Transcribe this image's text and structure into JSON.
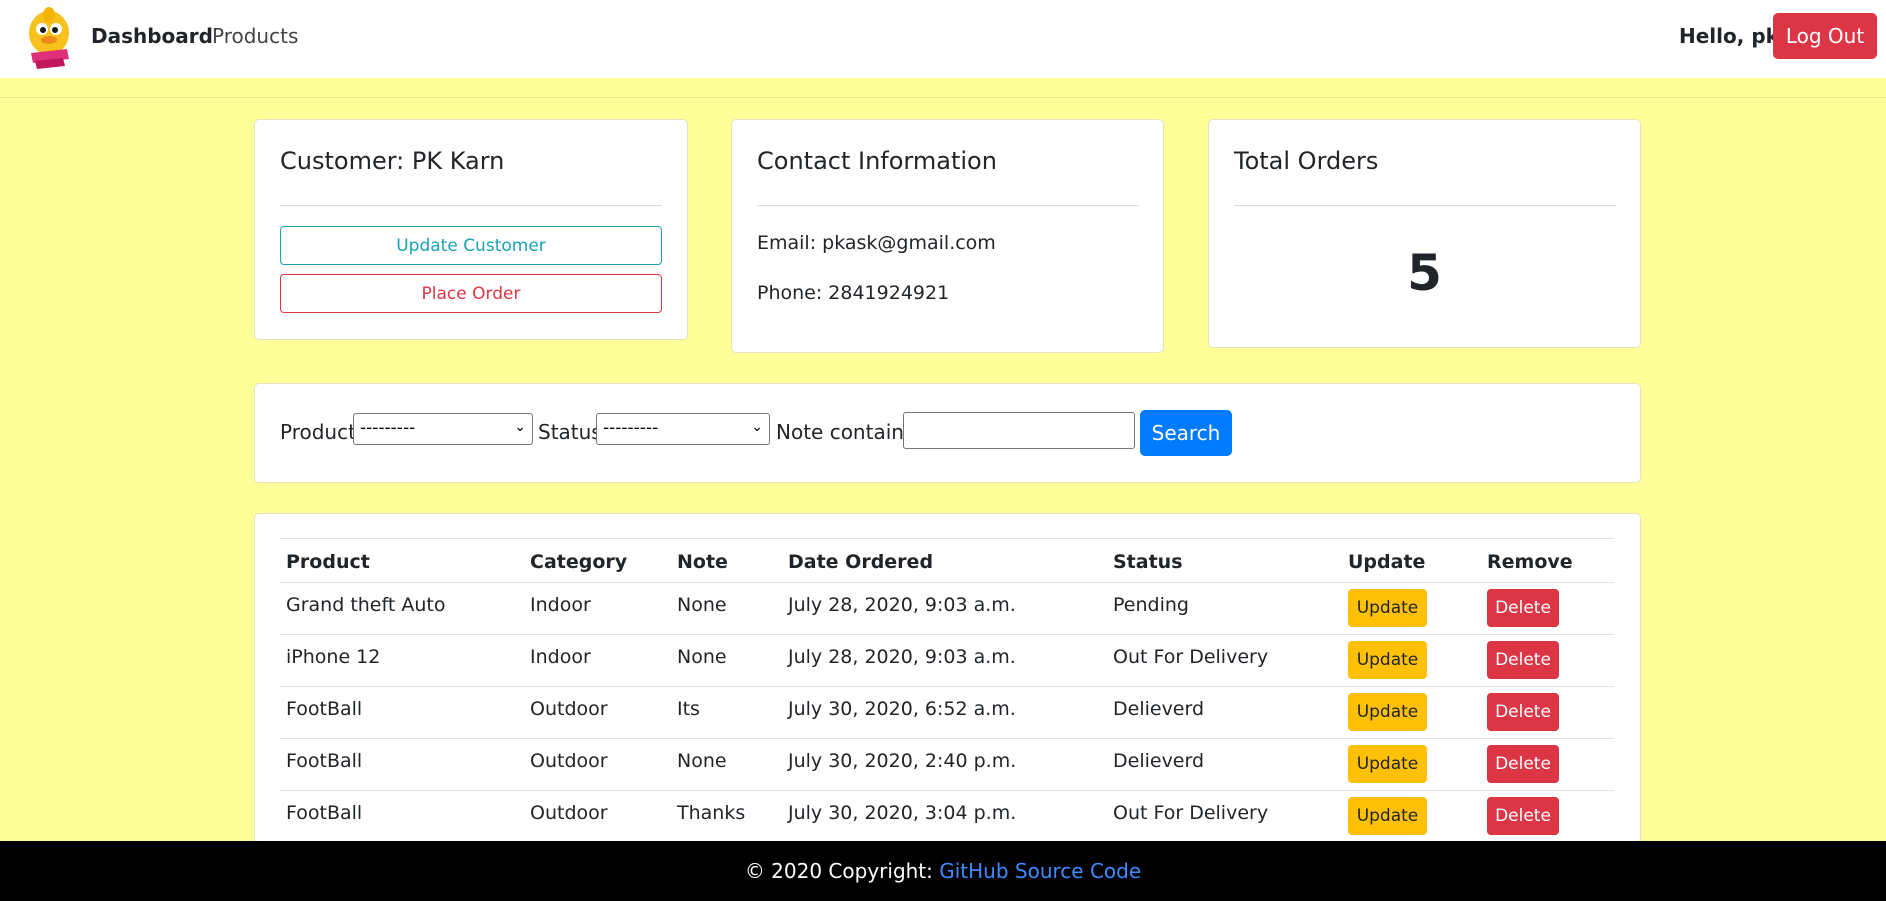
{
  "nav": {
    "brand": "Dashboard",
    "products": "Products",
    "hello": "Hello, pk",
    "logout": "Log Out"
  },
  "customer_card": {
    "title": "Customer: PK Karn",
    "update_button": "Update Customer",
    "place_order_button": "Place Order"
  },
  "contact_card": {
    "title": "Contact Information",
    "email": "Email: pkask@gmail.com",
    "phone": "Phone: 2841924921"
  },
  "orders_card": {
    "title": "Total Orders",
    "count": "5"
  },
  "filter": {
    "product_label": "Product:",
    "product_value": "---------",
    "status_label": "Status:",
    "status_value": "---------",
    "note_label": "Note contains:",
    "note_value": "",
    "search_button": "Search"
  },
  "table": {
    "headers": [
      "Product",
      "Category",
      "Note",
      "Date Ordered",
      "Status",
      "Update",
      "Remove"
    ],
    "rows": [
      {
        "product": "Grand theft Auto",
        "category": "Indoor",
        "note": "None",
        "date": "July 28, 2020, 9:03 a.m.",
        "status": "Pending",
        "update": "Update",
        "remove": "Delete"
      },
      {
        "product": "iPhone 12",
        "category": "Indoor",
        "note": "None",
        "date": "July 28, 2020, 9:03 a.m.",
        "status": "Out For Delivery",
        "update": "Update",
        "remove": "Delete"
      },
      {
        "product": "FootBall",
        "category": "Outdoor",
        "note": "Its",
        "date": "July 30, 2020, 6:52 a.m.",
        "status": "Delieverd",
        "update": "Update",
        "remove": "Delete"
      },
      {
        "product": "FootBall",
        "category": "Outdoor",
        "note": "None",
        "date": "July 30, 2020, 2:40 p.m.",
        "status": "Delieverd",
        "update": "Update",
        "remove": "Delete"
      },
      {
        "product": "FootBall",
        "category": "Outdoor",
        "note": "Thanks",
        "date": "July 30, 2020, 3:04 p.m.",
        "status": "Out For Delivery",
        "update": "Update",
        "remove": "Delete"
      }
    ]
  },
  "footer": {
    "copyright": "© 2020 Copyright: ",
    "link": "GitHub Source Code"
  },
  "colors": {
    "page_bg": "#ffff99",
    "danger": "#dc3545",
    "warning": "#ffc107",
    "primary": "#007bff",
    "info": "#17a2b8"
  }
}
